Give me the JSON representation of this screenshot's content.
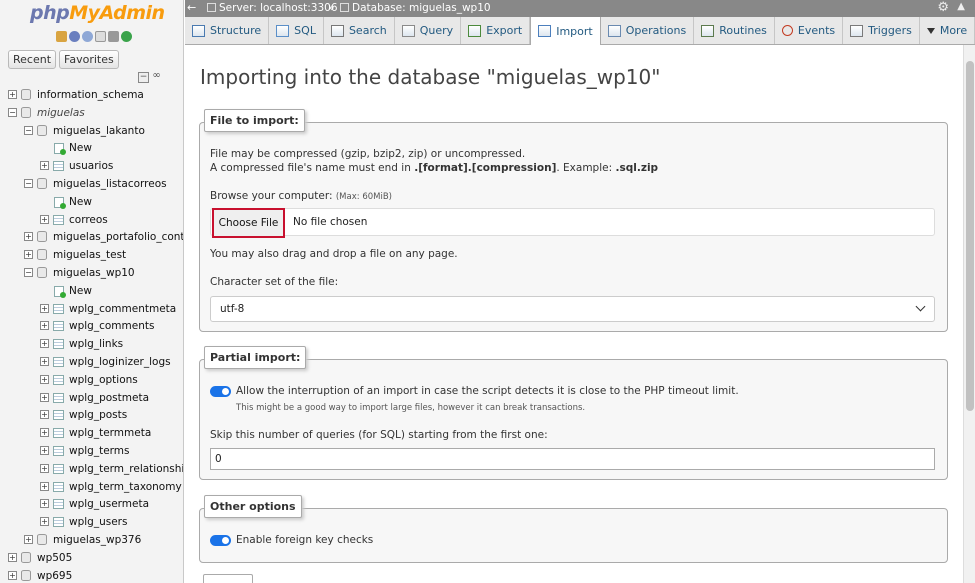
{
  "sidebar": {
    "logo_php": "php",
    "logo_my": "MyAdmin",
    "recent_label": "Recent",
    "favorites_label": "Favorites",
    "tree": [
      {
        "label": "information_schema",
        "level": 0,
        "kind": "db"
      },
      {
        "label": "miguelas",
        "level": 0,
        "kind": "group"
      },
      {
        "label": "miguelas_lakanto",
        "level": 1,
        "kind": "db"
      },
      {
        "label": "New",
        "level": 2,
        "kind": "new"
      },
      {
        "label": "usuarios",
        "level": 2,
        "kind": "table"
      },
      {
        "label": "miguelas_listacorreos",
        "level": 1,
        "kind": "db"
      },
      {
        "label": "New",
        "level": 2,
        "kind": "new"
      },
      {
        "label": "correos",
        "level": 2,
        "kind": "table"
      },
      {
        "label": "miguelas_portafolio_contacts",
        "level": 1,
        "kind": "db"
      },
      {
        "label": "miguelas_test",
        "level": 1,
        "kind": "db"
      },
      {
        "label": "miguelas_wp10",
        "level": 1,
        "kind": "db"
      },
      {
        "label": "New",
        "level": 2,
        "kind": "new"
      },
      {
        "label": "wplg_commentmeta",
        "level": 2,
        "kind": "table"
      },
      {
        "label": "wplg_comments",
        "level": 2,
        "kind": "table"
      },
      {
        "label": "wplg_links",
        "level": 2,
        "kind": "table"
      },
      {
        "label": "wplg_loginizer_logs",
        "level": 2,
        "kind": "table"
      },
      {
        "label": "wplg_options",
        "level": 2,
        "kind": "table"
      },
      {
        "label": "wplg_postmeta",
        "level": 2,
        "kind": "table"
      },
      {
        "label": "wplg_posts",
        "level": 2,
        "kind": "table"
      },
      {
        "label": "wplg_termmeta",
        "level": 2,
        "kind": "table"
      },
      {
        "label": "wplg_terms",
        "level": 2,
        "kind": "table"
      },
      {
        "label": "wplg_term_relationships",
        "level": 2,
        "kind": "table"
      },
      {
        "label": "wplg_term_taxonomy",
        "level": 2,
        "kind": "table"
      },
      {
        "label": "wplg_usermeta",
        "level": 2,
        "kind": "table"
      },
      {
        "label": "wplg_users",
        "level": 2,
        "kind": "table"
      },
      {
        "label": "miguelas_wp376",
        "level": 1,
        "kind": "db"
      },
      {
        "label": "wp505",
        "level": 0,
        "kind": "db"
      },
      {
        "label": "wp695",
        "level": 0,
        "kind": "db"
      }
    ]
  },
  "topbar": {
    "server": "Server: localhost:3306",
    "separator": "»",
    "database": "Database: miguelas_wp10"
  },
  "tabs": [
    {
      "label": "Structure",
      "icon": "structure-icon"
    },
    {
      "label": "SQL",
      "icon": "sql-icon"
    },
    {
      "label": "Search",
      "icon": "search-icon"
    },
    {
      "label": "Query",
      "icon": "query-icon"
    },
    {
      "label": "Export",
      "icon": "export-icon"
    },
    {
      "label": "Import",
      "icon": "import-icon",
      "active": true
    },
    {
      "label": "Operations",
      "icon": "wrench-icon"
    },
    {
      "label": "Routines",
      "icon": "routines-icon"
    },
    {
      "label": "Events",
      "icon": "clock-icon"
    },
    {
      "label": "Triggers",
      "icon": "triggers-icon"
    },
    {
      "label": "More",
      "icon": "caret-down-icon"
    }
  ],
  "main": {
    "title": "Importing into the database \"miguelas_wp10\"",
    "file_import": {
      "legend": "File to import:",
      "compress_note": "File may be compressed (gzip, bzip2, zip) or uncompressed.",
      "name_note_pre": "A compressed file's name must end in ",
      "name_note_fmt": ".[format].[compression]",
      "name_note_mid": ". Example: ",
      "name_note_ex": ".sql.zip",
      "browse_label": "Browse your computer:",
      "max_size": "(Max: 60MiB)",
      "choose_button": "Choose File",
      "no_file": "No file chosen",
      "drag_note": "You may also drag and drop a file on any page.",
      "charset_label": "Character set of the file:",
      "charset_value": "utf-8"
    },
    "partial_import": {
      "legend": "Partial import:",
      "allow_interrupt": "Allow the interruption of an import in case the script detects it is close to the PHP timeout limit.",
      "allow_interrupt_note": "This might be a good way to import large files, however it can break transactions.",
      "skip_label": "Skip this number of queries (for SQL) starting from the first one:",
      "skip_value": "0"
    },
    "other_options": {
      "legend": "Other options",
      "foreign_keys": "Enable foreign key checks"
    }
  },
  "colors": {
    "toggle_on": "#1a73e8",
    "highlight_border": "#c8102e",
    "tab_text": "#235a81"
  }
}
